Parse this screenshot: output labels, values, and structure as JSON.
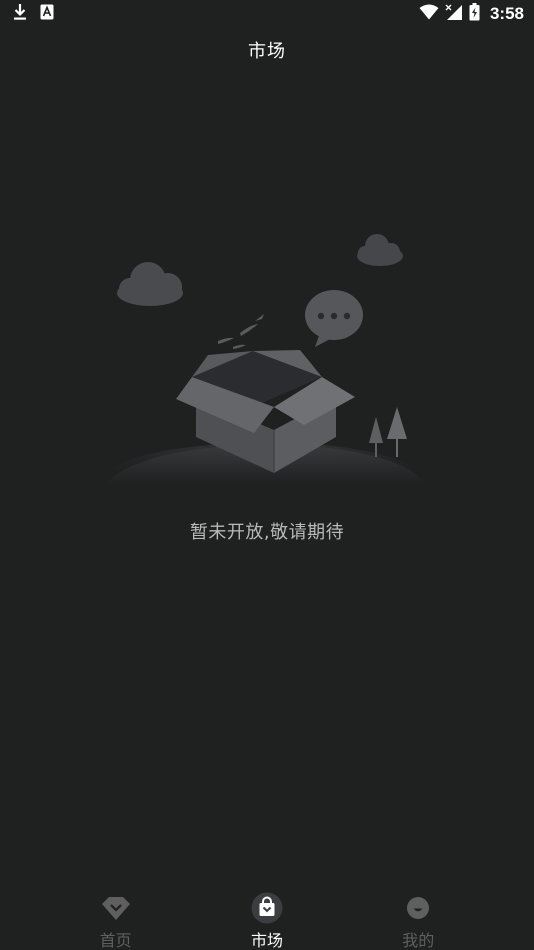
{
  "status_bar": {
    "time": "3:58",
    "icons": [
      "download-icon",
      "accessibility-a-icon",
      "wifi-icon",
      "signal-icon",
      "battery-charging-icon"
    ]
  },
  "header": {
    "title": "市场"
  },
  "empty_state": {
    "message": "暂未开放,敬请期待",
    "illustration": "open-box-icon"
  },
  "bottom_nav": {
    "items": [
      {
        "label": "首页",
        "icon": "home-diamond-icon",
        "active": false
      },
      {
        "label": "市场",
        "icon": "market-bag-icon",
        "active": true
      },
      {
        "label": "我的",
        "icon": "profile-face-icon",
        "active": false
      }
    ]
  },
  "colors": {
    "background": "#1f2020",
    "text_primary": "#ffffff",
    "text_secondary": "#b9b9b9",
    "nav_inactive": "#5f5f5f"
  }
}
